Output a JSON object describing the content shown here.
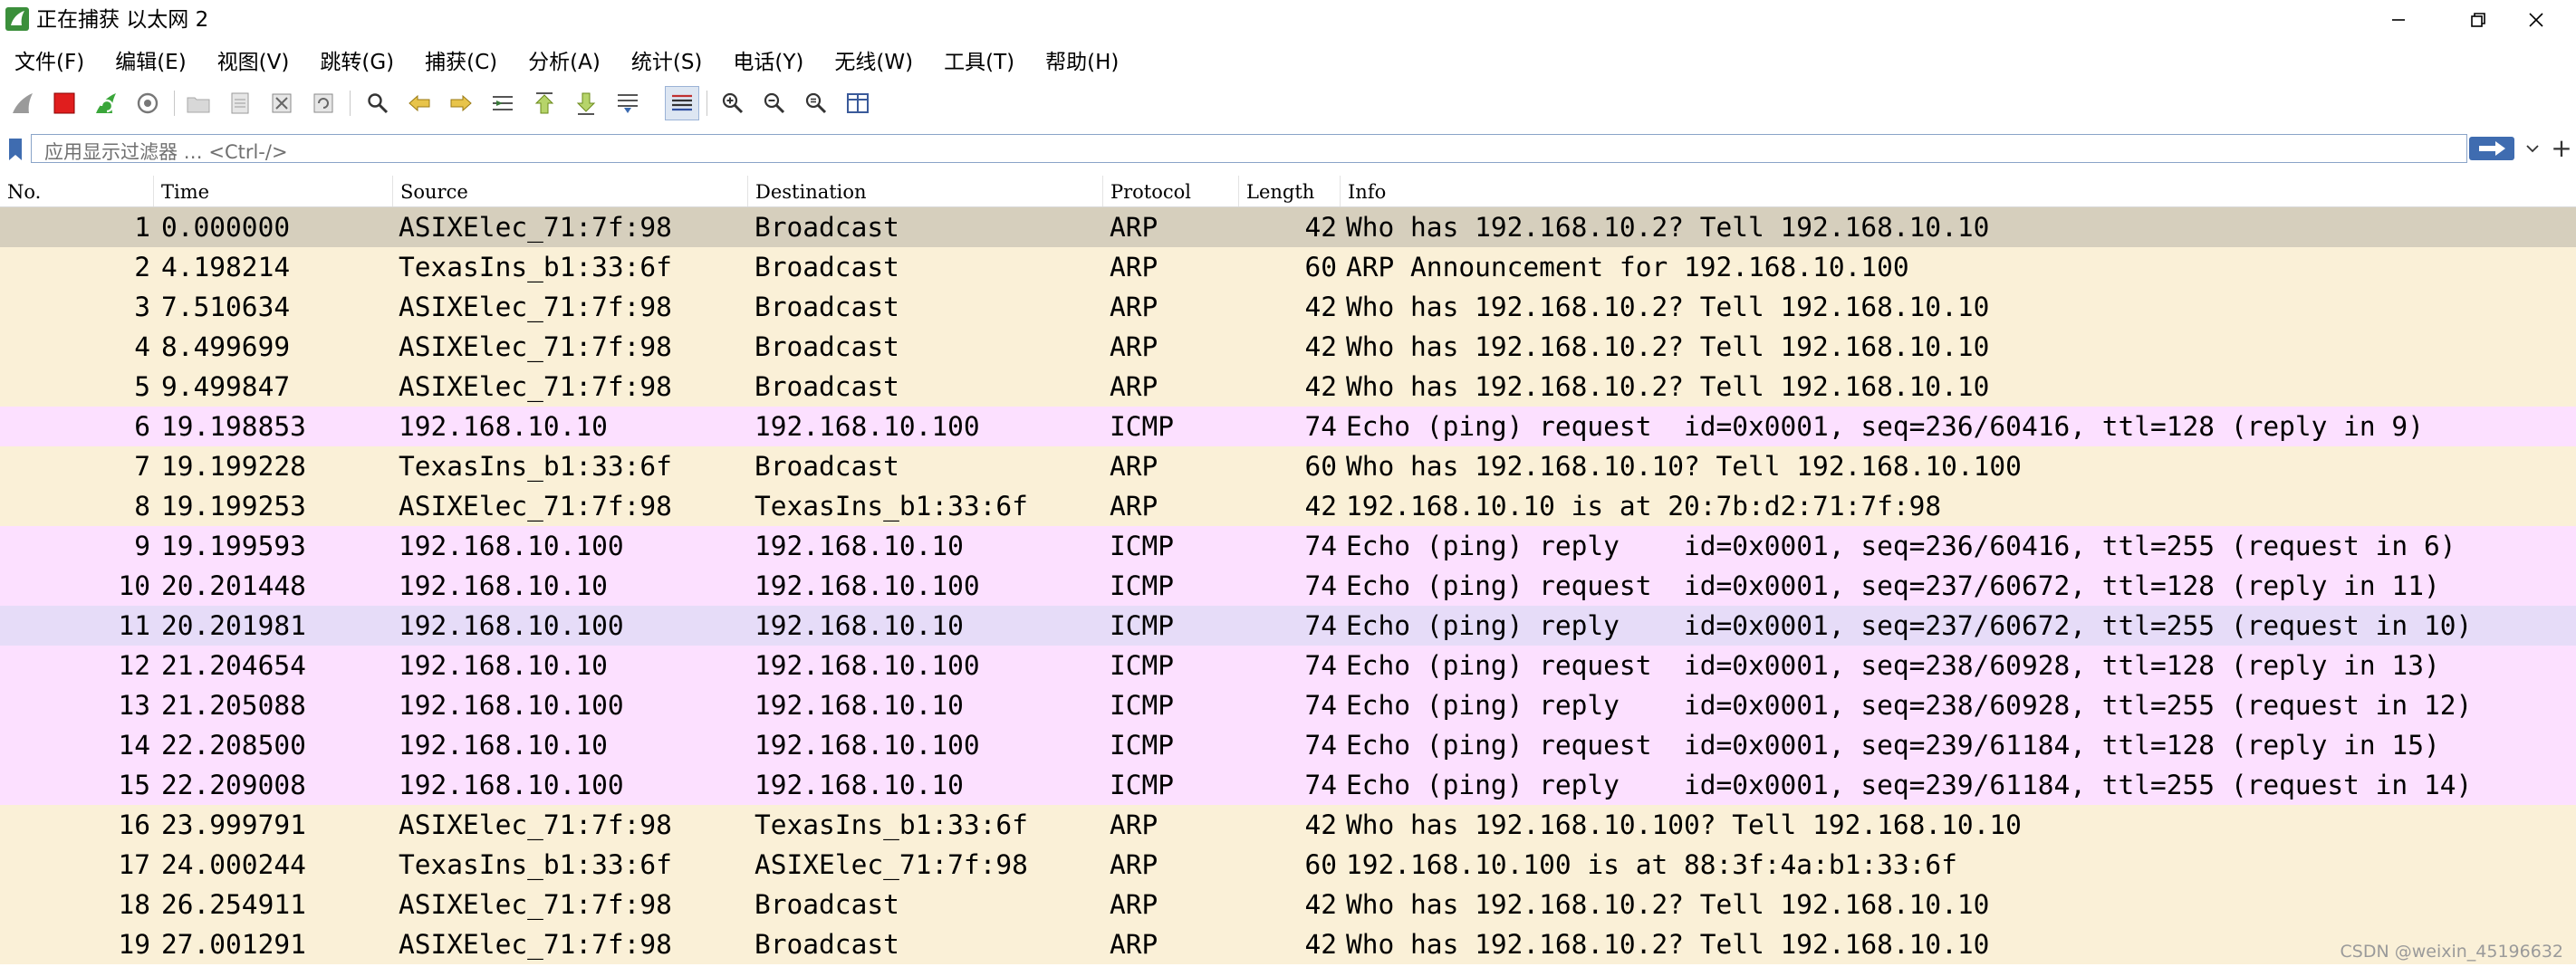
{
  "window": {
    "title": "正在捕获 以太网 2",
    "controls": [
      "minimize",
      "maximize",
      "close"
    ]
  },
  "menu": [
    "文件(F)",
    "编辑(E)",
    "视图(V)",
    "跳转(G)",
    "捕获(C)",
    "分析(A)",
    "统计(S)",
    "电话(Y)",
    "无线(W)",
    "工具(T)",
    "帮助(H)"
  ],
  "toolbar": {
    "icons": [
      "shark-fin-start-icon",
      "stop-capture-icon",
      "restart-capture-icon",
      "capture-options-icon",
      "open-file-icon",
      "save-file-icon",
      "close-file-icon",
      "reload-file-icon",
      "find-packet-icon",
      "go-back-icon",
      "go-forward-icon",
      "go-to-packet-icon",
      "first-packet-icon",
      "last-packet-icon",
      "auto-scroll-icon",
      "colorize-icon",
      "zoom-in-icon",
      "zoom-out-icon",
      "normal-size-icon",
      "resize-columns-icon"
    ]
  },
  "filter": {
    "placeholder": "应用显示过滤器 … <Ctrl-/>",
    "add_label": "+"
  },
  "packet_list": {
    "columns": [
      "No.",
      "Time",
      "Source",
      "Destination",
      "Protocol",
      "Length",
      "Info"
    ],
    "selected_row": 1,
    "rows": [
      {
        "no": "1",
        "time": "0.000000",
        "source": "ASIXElec_71:7f:98",
        "destination": "Broadcast",
        "protocol": "ARP",
        "length": "42",
        "info": "Who has 192.168.10.2? Tell 192.168.10.10",
        "color": "#d6cfbd"
      },
      {
        "no": "2",
        "time": "4.198214",
        "source": "TexasIns_b1:33:6f",
        "destination": "Broadcast",
        "protocol": "ARP",
        "length": "60",
        "info": "ARP Announcement for 192.168.10.100",
        "color": "#faf0d7"
      },
      {
        "no": "3",
        "time": "7.510634",
        "source": "ASIXElec_71:7f:98",
        "destination": "Broadcast",
        "protocol": "ARP",
        "length": "42",
        "info": "Who has 192.168.10.2? Tell 192.168.10.10",
        "color": "#faf0d7"
      },
      {
        "no": "4",
        "time": "8.499699",
        "source": "ASIXElec_71:7f:98",
        "destination": "Broadcast",
        "protocol": "ARP",
        "length": "42",
        "info": "Who has 192.168.10.2? Tell 192.168.10.10",
        "color": "#faf0d7"
      },
      {
        "no": "5",
        "time": "9.499847",
        "source": "ASIXElec_71:7f:98",
        "destination": "Broadcast",
        "protocol": "ARP",
        "length": "42",
        "info": "Who has 192.168.10.2? Tell 192.168.10.10",
        "color": "#faf0d7"
      },
      {
        "no": "6",
        "time": "19.198853",
        "source": "192.168.10.10",
        "destination": "192.168.10.100",
        "protocol": "ICMP",
        "length": "74",
        "info": "Echo (ping) request  id=0x0001, seq=236/60416, ttl=128 (reply in 9)",
        "color": "#fce0ff"
      },
      {
        "no": "7",
        "time": "19.199228",
        "source": "TexasIns_b1:33:6f",
        "destination": "Broadcast",
        "protocol": "ARP",
        "length": "60",
        "info": "Who has 192.168.10.10? Tell 192.168.10.100",
        "color": "#faf0d7"
      },
      {
        "no": "8",
        "time": "19.199253",
        "source": "ASIXElec_71:7f:98",
        "destination": "TexasIns_b1:33:6f",
        "protocol": "ARP",
        "length": "42",
        "info": "192.168.10.10 is at 20:7b:d2:71:7f:98",
        "color": "#faf0d7"
      },
      {
        "no": "9",
        "time": "19.199593",
        "source": "192.168.10.100",
        "destination": "192.168.10.10",
        "protocol": "ICMP",
        "length": "74",
        "info": "Echo (ping) reply    id=0x0001, seq=236/60416, ttl=255 (request in 6)",
        "color": "#fce0ff"
      },
      {
        "no": "10",
        "time": "20.201448",
        "source": "192.168.10.10",
        "destination": "192.168.10.100",
        "protocol": "ICMP",
        "length": "74",
        "info": "Echo (ping) request  id=0x0001, seq=237/60672, ttl=128 (reply in 11)",
        "color": "#fce0ff"
      },
      {
        "no": "11",
        "time": "20.201981",
        "source": "192.168.10.100",
        "destination": "192.168.10.10",
        "protocol": "ICMP",
        "length": "74",
        "info": "Echo (ping) reply    id=0x0001, seq=237/60672, ttl=255 (request in 10)",
        "color": "#e6dcf8"
      },
      {
        "no": "12",
        "time": "21.204654",
        "source": "192.168.10.10",
        "destination": "192.168.10.100",
        "protocol": "ICMP",
        "length": "74",
        "info": "Echo (ping) request  id=0x0001, seq=238/60928, ttl=128 (reply in 13)",
        "color": "#fce0ff"
      },
      {
        "no": "13",
        "time": "21.205088",
        "source": "192.168.10.100",
        "destination": "192.168.10.10",
        "protocol": "ICMP",
        "length": "74",
        "info": "Echo (ping) reply    id=0x0001, seq=238/60928, ttl=255 (request in 12)",
        "color": "#fce0ff"
      },
      {
        "no": "14",
        "time": "22.208500",
        "source": "192.168.10.10",
        "destination": "192.168.10.100",
        "protocol": "ICMP",
        "length": "74",
        "info": "Echo (ping) request  id=0x0001, seq=239/61184, ttl=128 (reply in 15)",
        "color": "#fce0ff"
      },
      {
        "no": "15",
        "time": "22.209008",
        "source": "192.168.10.100",
        "destination": "192.168.10.10",
        "protocol": "ICMP",
        "length": "74",
        "info": "Echo (ping) reply    id=0x0001, seq=239/61184, ttl=255 (request in 14)",
        "color": "#fce0ff"
      },
      {
        "no": "16",
        "time": "23.999791",
        "source": "ASIXElec_71:7f:98",
        "destination": "TexasIns_b1:33:6f",
        "protocol": "ARP",
        "length": "42",
        "info": "Who has 192.168.10.100? Tell 192.168.10.10",
        "color": "#faf0d7"
      },
      {
        "no": "17",
        "time": "24.000244",
        "source": "TexasIns_b1:33:6f",
        "destination": "ASIXElec_71:7f:98",
        "protocol": "ARP",
        "length": "60",
        "info": "192.168.10.100 is at 88:3f:4a:b1:33:6f",
        "color": "#faf0d7"
      },
      {
        "no": "18",
        "time": "26.254911",
        "source": "ASIXElec_71:7f:98",
        "destination": "Broadcast",
        "protocol": "ARP",
        "length": "42",
        "info": "Who has 192.168.10.2? Tell 192.168.10.10",
        "color": "#faf0d7"
      },
      {
        "no": "19",
        "time": "27.001291",
        "source": "ASIXElec_71:7f:98",
        "destination": "Broadcast",
        "protocol": "ARP",
        "length": "42",
        "info": "Who has 192.168.10.2? Tell 192.168.10.10",
        "color": "#faf0d7"
      }
    ]
  },
  "watermark": "CSDN @weixin_45196632"
}
